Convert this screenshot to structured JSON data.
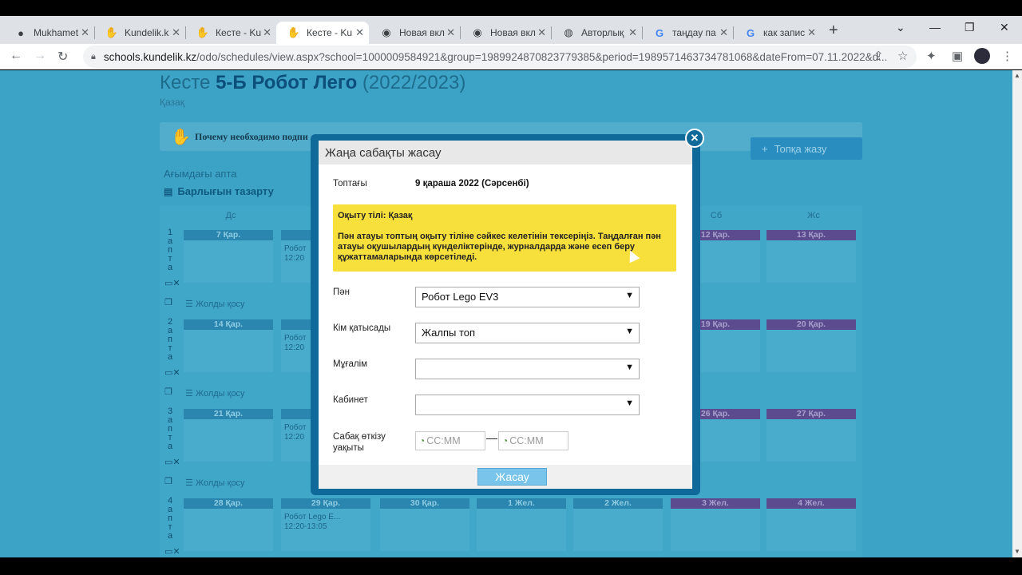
{
  "browser": {
    "tabs": [
      {
        "label": "Mukhamet",
        "icon": "github-icon",
        "active": false
      },
      {
        "label": "Kundelik.k",
        "icon": "kundelik-icon",
        "active": false
      },
      {
        "label": "Кесте - Ku",
        "icon": "kundelik-icon",
        "active": false
      },
      {
        "label": "Кесте - Ku",
        "icon": "kundelik-icon",
        "active": true
      },
      {
        "label": "Новая вкл",
        "icon": "chrome-icon",
        "active": false
      },
      {
        "label": "Новая вкл",
        "icon": "chrome-icon",
        "active": false
      },
      {
        "label": "Авторлық",
        "icon": "globe-icon",
        "active": false
      },
      {
        "label": "таңдау па",
        "icon": "google-icon",
        "active": false
      },
      {
        "label": "как запис",
        "icon": "google-icon",
        "active": false
      }
    ],
    "url_domain": "schools.kundelik.kz",
    "url_rest": "/odo/schedules/view.aspx?school=1000009584921&group=1989924870823779385&period=1989571463734781068&dateFrom=07.11.2022&d..."
  },
  "page": {
    "title_prefix": "Кесте",
    "title_bold": "5-Б Робот Лего",
    "title_suffix": "(2022/2023)",
    "subtitle": "Қазақ",
    "notice_text": "Почему необходимо подпи",
    "add_button": "Топқа жазу",
    "current_week": "Ағымдағы апта",
    "clear_all": "Барлығын тазарту",
    "add_row": "Жолды қосу",
    "days": [
      "Дс",
      "Сб",
      "Жс"
    ],
    "weeks": [
      {
        "num": "1",
        "letters": [
          "а",
          "п",
          "т",
          "а"
        ],
        "dates": [
          "7 Қар.",
          "12 Қар.",
          "13 Қар."
        ],
        "lesson_name": "Робот",
        "lesson_time": "12:20"
      },
      {
        "num": "2",
        "letters": [
          "а",
          "п",
          "т",
          "а"
        ],
        "dates": [
          "14 Қар.",
          "19 Қар.",
          "20 Қар."
        ],
        "lesson_name": "Робот",
        "lesson_time": "12:20"
      },
      {
        "num": "3",
        "letters": [
          "а",
          "п",
          "т",
          "а"
        ],
        "dates": [
          "21 Қар.",
          "26 Қар.",
          "27 Қар."
        ],
        "lesson_name": "Робот",
        "lesson_time": "12:20"
      },
      {
        "num": "4",
        "letters": [
          "а",
          "п",
          "т",
          "а"
        ],
        "dates": [
          "28 Қар.",
          "29 Қар.",
          "30 Қар.",
          "1 Жел.",
          "2 Жел.",
          "3 Жел.",
          "4 Жел."
        ],
        "lesson_name": "Робот Lego E...",
        "lesson_time": "12:20-13:05"
      }
    ]
  },
  "modal": {
    "title": "Жаңа сабақты жасау",
    "date_label": "Топтағы",
    "date_value": "9 қараша 2022 (Сәрсенбі)",
    "warning_line1": "Оқыту тілі: Қазақ",
    "warning_line2": "Пән атауы топтың оқыту тіліне сәйкес келетінін тексеріңіз. Таңдалған пән атауы оқушылардың күнделіктерінде, журналдарда және есеп беру құжаттамаларында көрсетіледі.",
    "subject_label": "Пән",
    "subject_value": "Робот Lego EV3",
    "who_label": "Кім қатысады",
    "who_value": "Жалпы топ",
    "teacher_label": "Мұғалім",
    "teacher_value": "",
    "room_label": "Кабинет",
    "room_value": "",
    "time_label": "Сабақ өткізу уақыты",
    "time_placeholder": "СС:ММ",
    "create_button": "Жасау"
  }
}
